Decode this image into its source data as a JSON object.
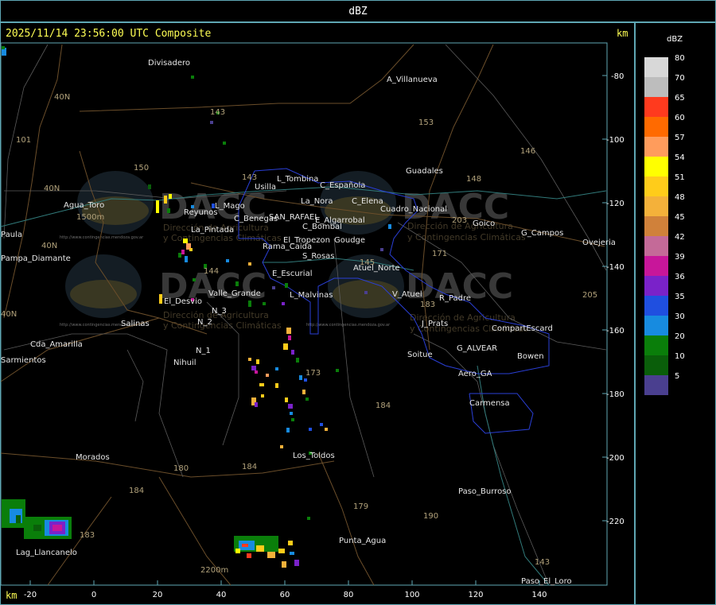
{
  "header": {
    "title": "dBZ"
  },
  "map": {
    "timestamp": "2025/11/14 23:56:00 UTC Composite",
    "km_label_top": "km",
    "km_label_bottom": "km",
    "watermark": {
      "brand": "DACC",
      "line1": "Dirección de Agricultura",
      "line2": "y Contingencias Climáticas",
      "url": "http://www.contingencias.mendoza.gov.ar"
    },
    "x_ticks": [
      "-20",
      "0",
      "20",
      "40",
      "60",
      "80",
      "100",
      "120",
      "140"
    ],
    "y_ticks": [
      "-80",
      "-100",
      "-120",
      "-140",
      "-160",
      "-180",
      "-200",
      "-220"
    ],
    "places": [
      "Divisadero",
      "A_Villanueva",
      "Guadales",
      "L_Tombina",
      "Usilla",
      "C_Española",
      "La_Nora",
      "C_Elena",
      "Goico",
      "G_Campos",
      "Ovejeria",
      "Agua_Toro",
      "Reyunos",
      "L_Mago",
      "C_Benegas",
      "SAN_RAFAEL",
      "E_Algarrobal",
      "C_Bombal",
      "Cuadro_Nacional",
      "Rama_Caida",
      "El_Tropezon",
      "Goudge",
      "La_Pintada",
      "S_Rosas",
      "Atuel_Norte",
      "E_Escurial",
      "Pampa_Diamante",
      "Paula",
      "El_Desvio",
      "Valle_Grande",
      "L_Malvinas",
      "V_Atuel",
      "R_Padre",
      "Salinas",
      "N_2",
      "N_3",
      "J_Prats",
      "CompartEscard",
      "Cda_Amarilla",
      "Nihuil",
      "N_1",
      "G_ALVEAR",
      "Soitue",
      "Bowen",
      "Sarmientos",
      "Aero_GA",
      "Carmensa",
      "Morados",
      "Los_Toldos",
      "Paso_Burroso",
      "Lag_Llancanelo",
      "Punta_Agua",
      "Paso_El_Loro"
    ],
    "routes": [
      "101",
      "40N",
      "40N",
      "40N",
      "40N",
      "153",
      "146",
      "143",
      "150",
      "143",
      "148",
      "203",
      "171",
      "144",
      "183",
      "145",
      "173",
      "184",
      "180",
      "184",
      "179",
      "190",
      "183",
      "143",
      "205"
    ],
    "elevations": [
      "1500m",
      "2200m"
    ]
  },
  "legend": {
    "title": "dBZ",
    "levels": [
      {
        "label": "80",
        "color": "#d8d8d8"
      },
      {
        "label": "70",
        "color": "#bdbdbd"
      },
      {
        "label": "65",
        "color": "#ff3a1e"
      },
      {
        "label": "60",
        "color": "#ff6a00"
      },
      {
        "label": "57",
        "color": "#ff9c5c"
      },
      {
        "label": "54",
        "color": "#ffff00"
      },
      {
        "label": "51",
        "color": "#ffcc1a"
      },
      {
        "label": "48",
        "color": "#f4b13a"
      },
      {
        "label": "45",
        "color": "#d0813a"
      },
      {
        "label": "42",
        "color": "#c46a98"
      },
      {
        "label": "39",
        "color": "#c8169a"
      },
      {
        "label": "36",
        "color": "#7a22c9"
      },
      {
        "label": "35",
        "color": "#1f4fe0"
      },
      {
        "label": "30",
        "color": "#178be0"
      },
      {
        "label": "20",
        "color": "#0a7e0a"
      },
      {
        "label": "10",
        "color": "#0a5e0a"
      },
      {
        "label": "5",
        "color": "#4a3f8f"
      }
    ]
  }
}
